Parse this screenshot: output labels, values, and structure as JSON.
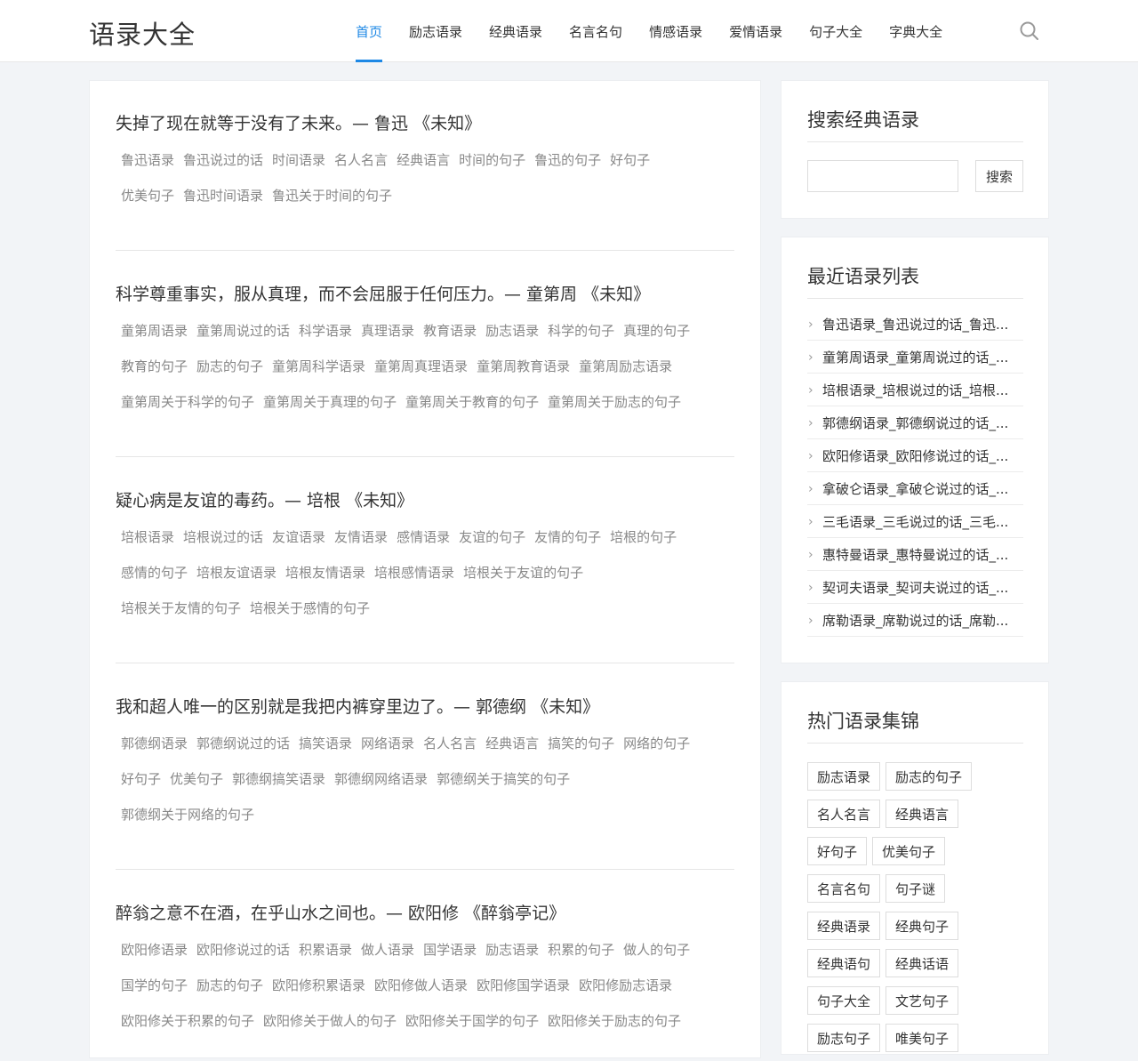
{
  "site": {
    "logo": "语录大全"
  },
  "nav": [
    "首页",
    "励志语录",
    "经典语录",
    "名言名句",
    "情感语录",
    "爱情语录",
    "句子大全",
    "字典大全"
  ],
  "posts": [
    {
      "title": "失掉了现在就等于没有了未来。— 鲁迅 《未知》",
      "tag_rows": [
        [
          "鲁迅语录",
          "鲁迅说过的话",
          "时间语录",
          "名人名言",
          "经典语言",
          "时间的句子",
          "鲁迅的句子",
          "好句子"
        ],
        [
          "优美句子",
          "鲁迅时间语录",
          "鲁迅关于时间的句子"
        ]
      ]
    },
    {
      "title": "科学尊重事实，服从真理，而不会屈服于任何压力。— 童第周 《未知》",
      "tag_rows": [
        [
          "童第周语录",
          "童第周说过的话",
          "科学语录",
          "真理语录",
          "教育语录",
          "励志语录",
          "科学的句子",
          "真理的句子"
        ],
        [
          "教育的句子",
          "励志的句子",
          "童第周科学语录",
          "童第周真理语录",
          "童第周教育语录",
          "童第周励志语录"
        ],
        [
          "童第周关于科学的句子",
          "童第周关于真理的句子",
          "童第周关于教育的句子",
          "童第周关于励志的句子"
        ]
      ]
    },
    {
      "title": "疑心病是友谊的毒药。— 培根 《未知》",
      "tag_rows": [
        [
          "培根语录",
          "培根说过的话",
          "友谊语录",
          "友情语录",
          "感情语录",
          "友谊的句子",
          "友情的句子",
          "培根的句子"
        ],
        [
          "感情的句子",
          "培根友谊语录",
          "培根友情语录",
          "培根感情语录",
          "培根关于友谊的句子"
        ],
        [
          "培根关于友情的句子",
          "培根关于感情的句子"
        ]
      ]
    },
    {
      "title": "我和超人唯一的区别就是我把内裤穿里边了。— 郭德纲 《未知》",
      "tag_rows": [
        [
          "郭德纲语录",
          "郭德纲说过的话",
          "搞笑语录",
          "网络语录",
          "名人名言",
          "经典语言",
          "搞笑的句子",
          "网络的句子"
        ],
        [
          "好句子",
          "优美句子",
          "郭德纲搞笑语录",
          "郭德纲网络语录",
          "郭德纲关于搞笑的句子"
        ],
        [
          "郭德纲关于网络的句子"
        ]
      ]
    },
    {
      "title": "醉翁之意不在酒，在乎山水之间也。— 欧阳修 《醉翁亭记》",
      "tag_rows": [
        [
          "欧阳修语录",
          "欧阳修说过的话",
          "积累语录",
          "做人语录",
          "国学语录",
          "励志语录",
          "积累的句子",
          "做人的句子"
        ],
        [
          "国学的句子",
          "励志的句子",
          "欧阳修积累语录",
          "欧阳修做人语录",
          "欧阳修国学语录",
          "欧阳修励志语录"
        ],
        [
          "欧阳修关于积累的句子",
          "欧阳修关于做人的句子",
          "欧阳修关于国学的句子",
          "欧阳修关于励志的句子"
        ]
      ]
    }
  ],
  "search_widget": {
    "title": "搜索经典语录",
    "input_value": "",
    "button": "搜索"
  },
  "recent_widget": {
    "title": "最近语录列表",
    "items": [
      "鲁迅语录_鲁迅说过的话_鲁迅...",
      "童第周语录_童第周说过的话_...",
      "培根语录_培根说过的话_培根...",
      "郭德纲语录_郭德纲说过的话_...",
      "欧阳修语录_欧阳修说过的话_...",
      "拿破仑语录_拿破仑说过的话_...",
      "三毛语录_三毛说过的话_三毛...",
      "惠特曼语录_惠特曼说过的话_...",
      "契诃夫语录_契诃夫说过的话_...",
      "席勒语录_席勒说过的话_席勒..."
    ]
  },
  "hot_widget": {
    "title": "热门语录集锦",
    "rows": [
      [
        "励志语录",
        "励志的句子"
      ],
      [
        "名人名言",
        "经典语言"
      ],
      [
        "好句子",
        "优美句子"
      ],
      [
        "名言名句",
        "句子谜"
      ],
      [
        "经典语录",
        "经典句子"
      ],
      [
        "经典语句",
        "经典话语"
      ],
      [
        "句子大全",
        "文艺句子"
      ],
      [
        "励志句子",
        "唯美句子"
      ]
    ]
  },
  "icons": {
    "search": "search-icon",
    "chevron": "chevron-right-icon"
  },
  "colors": {
    "accent": "#1e88e5",
    "tag_text": "#888888",
    "background": "#f2f4f7"
  }
}
